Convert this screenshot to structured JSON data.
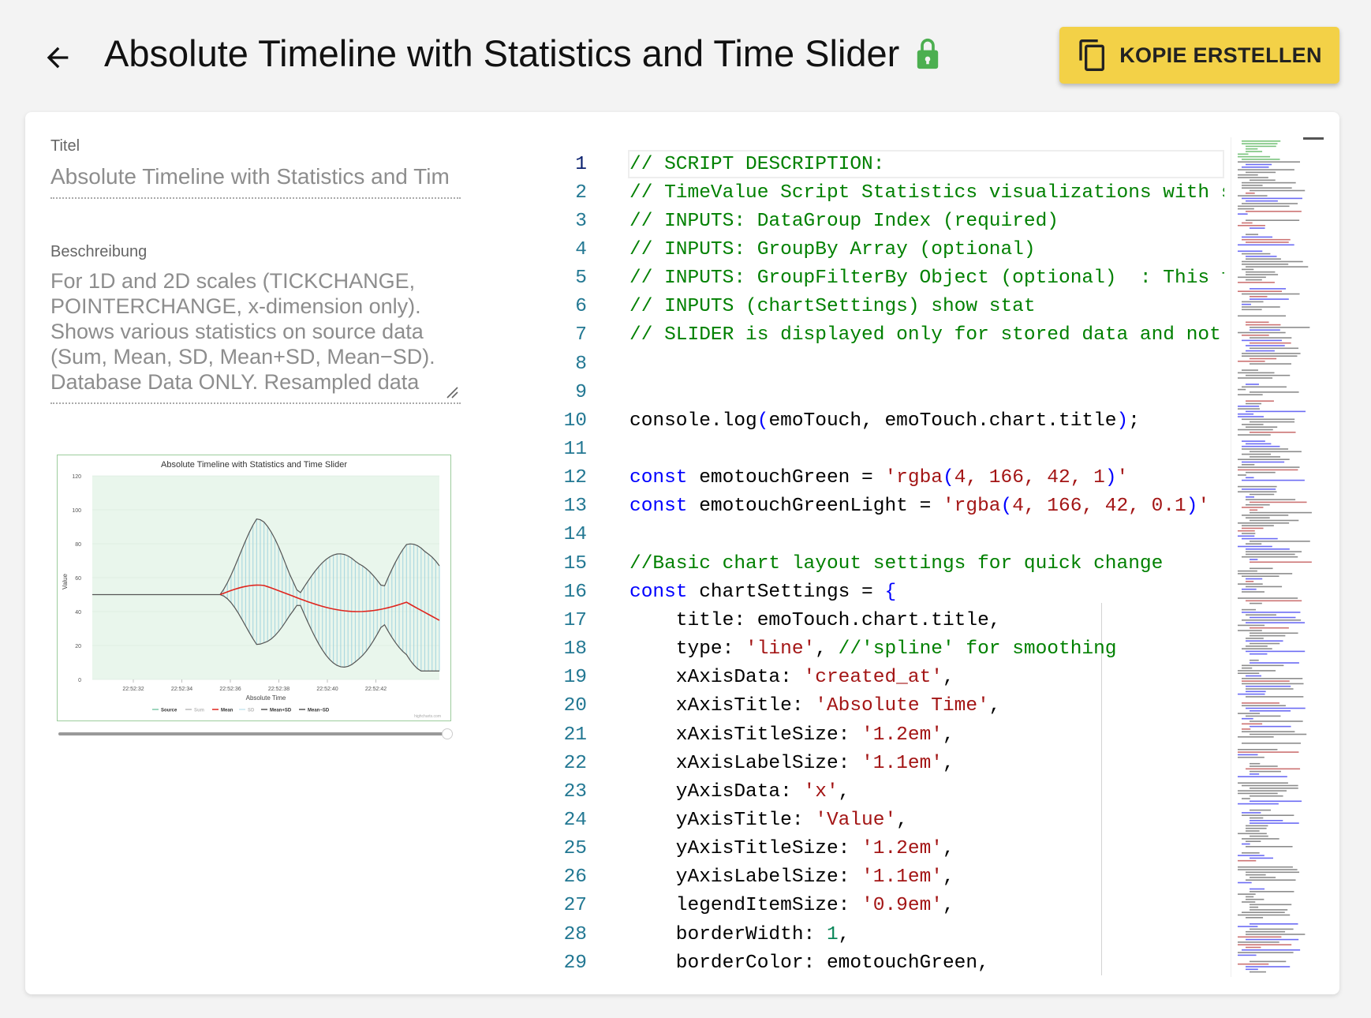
{
  "header": {
    "title": "Absolute Timeline with Statistics and Time Slider",
    "copy_button_label": "KOPIE ERSTELLEN"
  },
  "colors": {
    "accent_yellow": "#f3d147",
    "lock_green": "#4caf50",
    "code_comment": "#008000",
    "code_keyword": "#0000ff",
    "code_string": "#a31515",
    "code_number": "#098658"
  },
  "form": {
    "title_label": "Titel",
    "title_value": "Absolute Timeline with Statistics and Tim",
    "description_label": "Beschreibung",
    "description_lines": [
      "For 1D and 2D scales (TICKCHANGE,",
      "POINTERCHANGE, x-dimension only).",
      "Shows various statistics on source data",
      "(Sum, Mean, SD, Mean+SD, Mean−SD).",
      "Database Data ONLY. Resampled data"
    ]
  },
  "preview_chart": {
    "title": "Absolute Timeline with Statistics and Time Slider",
    "ylabel": "Value",
    "xlabel": "Absolute Time",
    "y_ticks": [
      "120",
      "100",
      "80",
      "60",
      "40",
      "20",
      "0"
    ],
    "x_ticks": [
      "22:52:32",
      "22:52:34",
      "22:52:36",
      "22:52:38",
      "22:52:40",
      "22:52:42"
    ],
    "legend": [
      "Source",
      "Sum",
      "Mean",
      "SD",
      "Mean+SD",
      "Mean−SD"
    ],
    "credit": "highcharts.com",
    "slider_position": 0.99
  },
  "code": {
    "lines": [
      {
        "n": "1",
        "t": "// SCRIPT DESCRIPTION:"
      },
      {
        "n": "2",
        "t": "// TimeValue Script Statistics visualizations with sl"
      },
      {
        "n": "3",
        "t": "// INPUTS: DataGroup Index (required)"
      },
      {
        "n": "4",
        "t": "// INPUTS: GroupBy Array (optional)"
      },
      {
        "n": "5",
        "t": "// INPUTS: GroupFilterBy Object (optional)  : This fi"
      },
      {
        "n": "6",
        "t": "// INPUTS (chartSettings) show stat"
      },
      {
        "n": "7",
        "t": "// SLIDER is displayed only for stored data and not"
      },
      {
        "n": "8",
        "t": ""
      },
      {
        "n": "9",
        "t": ""
      },
      {
        "n": "10",
        "t": "console.log(emoTouch, emoTouch.chart.title);"
      },
      {
        "n": "11",
        "t": ""
      },
      {
        "n": "12",
        "t": "const emotouchGreen = 'rgba(4, 166, 42, 1)'"
      },
      {
        "n": "13",
        "t": "const emotouchGreenLight = 'rgba(4, 166, 42, 0.1)'"
      },
      {
        "n": "14",
        "t": ""
      },
      {
        "n": "15",
        "t": "//Basic chart layout settings for quick change"
      },
      {
        "n": "16",
        "t": "const chartSettings = {"
      },
      {
        "n": "17",
        "t": "    title: emoTouch.chart.title,"
      },
      {
        "n": "18",
        "t": "    type: 'line', //'spline' for smoothing"
      },
      {
        "n": "19",
        "t": "    xAxisData: 'created_at',"
      },
      {
        "n": "20",
        "t": "    xAxisTitle: 'Absolute Time',"
      },
      {
        "n": "21",
        "t": "    xAxisTitleSize: '1.2em',"
      },
      {
        "n": "22",
        "t": "    xAxisLabelSize: '1.1em',"
      },
      {
        "n": "23",
        "t": "    yAxisData: 'x',"
      },
      {
        "n": "24",
        "t": "    yAxisTitle: 'Value',"
      },
      {
        "n": "25",
        "t": "    yAxisTitleSize: '1.2em',"
      },
      {
        "n": "26",
        "t": "    yAxisLabelSize: '1.1em',"
      },
      {
        "n": "27",
        "t": "    legendItemSize: '0.9em',"
      },
      {
        "n": "28",
        "t": "    borderWidth: 1,"
      },
      {
        "n": "29",
        "t": "    borderColor: emotouchGreen,"
      }
    ]
  }
}
